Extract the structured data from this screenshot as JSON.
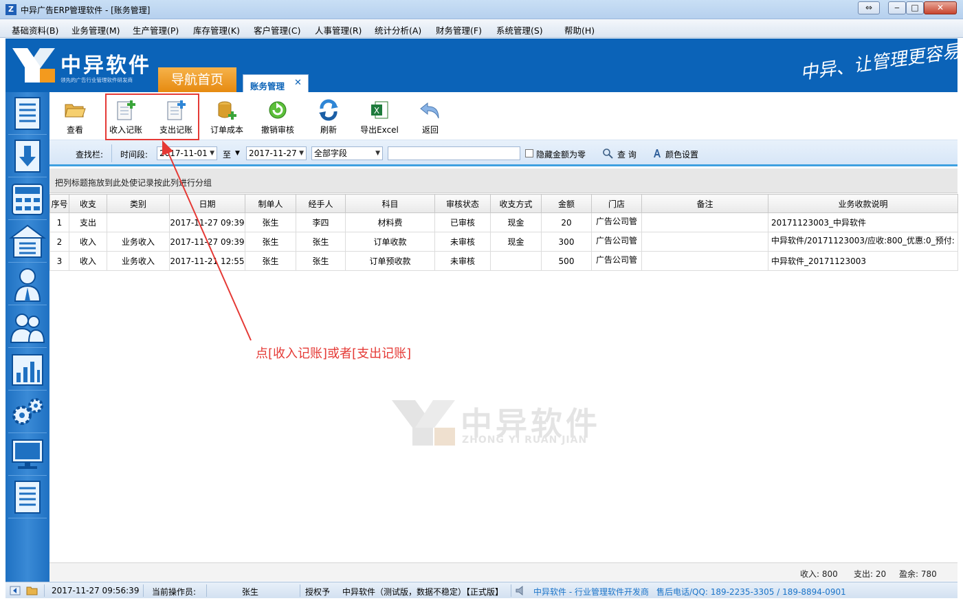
{
  "window": {
    "title": "中异广告ERP管理软件 - [账务管理]",
    "app_icon": "Z",
    "controls": [
      "⇔",
      "‒",
      "□",
      "✕"
    ]
  },
  "menu": [
    "基础资料(B)",
    "业务管理(M)",
    "生产管理(P)",
    "库存管理(K)",
    "客户管理(C)",
    "人事管理(R)",
    "统计分析(A)",
    "财务管理(F)",
    "系统管理(S)",
    "帮助(H)"
  ],
  "banner": {
    "brand": "中异软件",
    "brand_sub": "领先的广告行业管理软件研发商",
    "nav_home": "导航首页",
    "active_tab": "账务管理",
    "active_tab_close": "✕",
    "slogan": "中异、让管理更容易"
  },
  "sidebar": {
    "icons": [
      "ledger-icon",
      "import-icon",
      "calculator-icon",
      "warehouse-icon",
      "staff-icon",
      "customers-icon",
      "chart-icon",
      "settings-gears-icon",
      "monitor-icon",
      "document-icon"
    ]
  },
  "toolbar": {
    "buttons": [
      {
        "label": "查看",
        "icon": "folder-open-icon"
      },
      {
        "label": "收入记账",
        "icon": "income-entry-icon"
      },
      {
        "label": "支出记账",
        "icon": "expense-entry-icon"
      },
      {
        "label": "订单成本",
        "icon": "order-cost-icon"
      },
      {
        "label": "撤销审核",
        "icon": "undo-review-icon"
      },
      {
        "label": "刷新",
        "icon": "refresh-icon"
      },
      {
        "label": "导出Excel",
        "icon": "excel-export-icon"
      },
      {
        "label": "返回",
        "icon": "return-icon"
      }
    ]
  },
  "search": {
    "label": "查找栏:",
    "period_label": "时间段:",
    "date_from": "2017-11-01",
    "to_label": "至",
    "date_to": "2017-11-27",
    "field": "全部字段",
    "keyword": "",
    "hide_zero_label": "隐藏金额为零",
    "search_btn": "查 询",
    "color_btn": "颜色设置",
    "arrow": "▼"
  },
  "group_hint": "把列标题拖放到此处使记录按此列进行分组",
  "grid": {
    "columns": [
      "序号",
      "收支",
      "类别",
      "日期",
      "制单人",
      "经手人",
      "科目",
      "审核状态",
      "收支方式",
      "金额",
      "门店",
      "备注",
      "业务收款说明"
    ],
    "rows": [
      [
        "1",
        "支出",
        "",
        "2017-11-27 09:39",
        "张生",
        "李四",
        "材料费",
        "已审核",
        "现金",
        "20",
        "广告公司管",
        "",
        "20171123003_中异软件"
      ],
      [
        "2",
        "收入",
        "业务收入",
        "2017-11-27 09:39",
        "张生",
        "张生",
        "订单收款",
        "未审核",
        "现金",
        "300",
        "广告公司管",
        "",
        "中异软件/20171123003/应收:800_优惠:0_预付:"
      ],
      [
        "3",
        "收入",
        "业务收入",
        "2017-11-21 12:55",
        "张生",
        "张生",
        "订单预收款",
        "未审核",
        "",
        "500",
        "广告公司管",
        "",
        "中异软件_20171123003"
      ]
    ]
  },
  "watermark": {
    "text": "中异软件",
    "pinyin": "ZHONG YI RUAN JIAN"
  },
  "annotation": "点[收入记账]或者[支出记账]",
  "summary": {
    "income": "收入: 800",
    "expense": "支出: 20",
    "profit": "盈余: 780"
  },
  "status": {
    "datetime": "2017-11-27 09:56:39",
    "operator_label": "当前操作员:",
    "operator": "张生",
    "license_label": "授权予",
    "edition": "中异软件（测试版，数据不稳定）【正式版】",
    "company": "中异软件 - 行业管理软件开发商",
    "hotline": "售后电话/QQ: 189-2235-3305  / 189-8894-0901"
  },
  "colors": {
    "banner": "#0b63b8",
    "accent": "#e68a10",
    "annotation": "#e53935",
    "link": "#1a73c8"
  }
}
